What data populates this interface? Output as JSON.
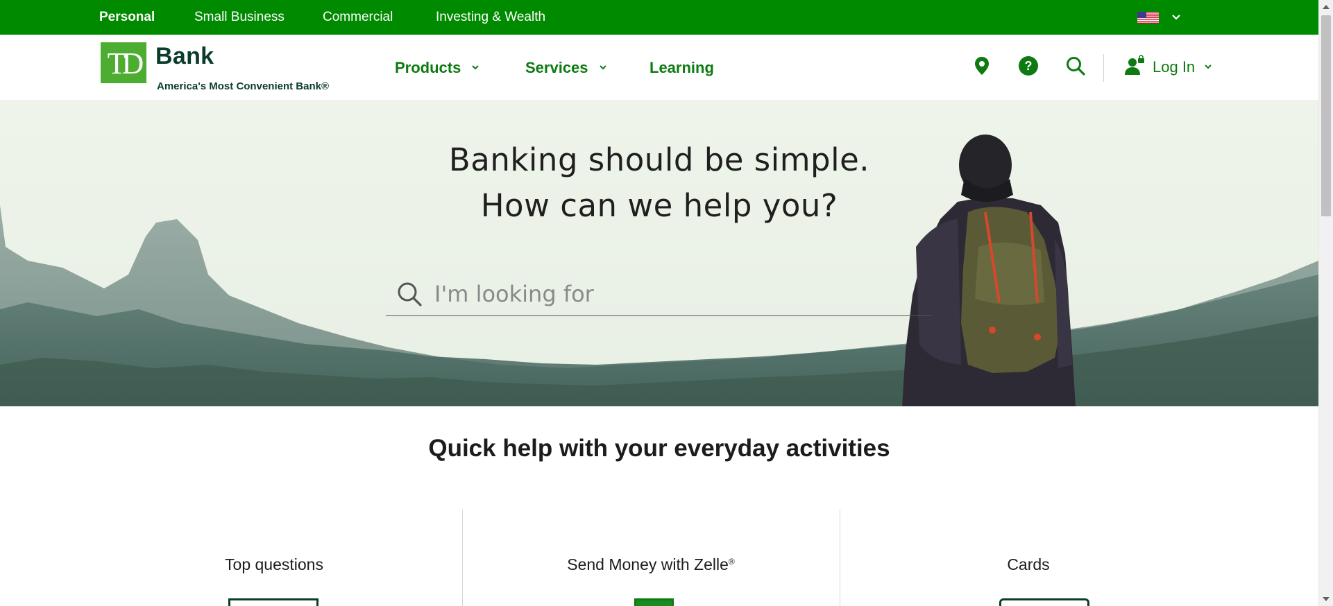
{
  "topbar": {
    "items": [
      {
        "label": "Personal",
        "active": true
      },
      {
        "label": "Small Business",
        "active": false
      },
      {
        "label": "Commercial",
        "active": false
      },
      {
        "label": "Investing & Wealth",
        "active": false
      }
    ],
    "region_icon": "us-flag-icon",
    "color": "#008a00"
  },
  "header": {
    "logo_text": "TD",
    "brand_name": "Bank",
    "tagline": "America's Most Convenient Bank®",
    "nav": [
      {
        "label": "Products",
        "has_dropdown": true
      },
      {
        "label": "Services",
        "has_dropdown": true
      },
      {
        "label": "Learning",
        "has_dropdown": false
      }
    ],
    "icons": [
      "location-pin-icon",
      "help-icon",
      "search-icon"
    ],
    "login_label": "Log In",
    "accent_color": "#0e7a12",
    "logo_color": "#4dad31"
  },
  "hero": {
    "line1": "Banking should be simple.",
    "line2": "How can we help you?",
    "search_placeholder": "I'm looking for"
  },
  "quick_help": {
    "title": "Quick help with your everyday activities",
    "cards": [
      {
        "title": "Top questions"
      },
      {
        "title": "Send Money with Zelle",
        "mark": "®"
      },
      {
        "title": "Cards"
      }
    ]
  }
}
